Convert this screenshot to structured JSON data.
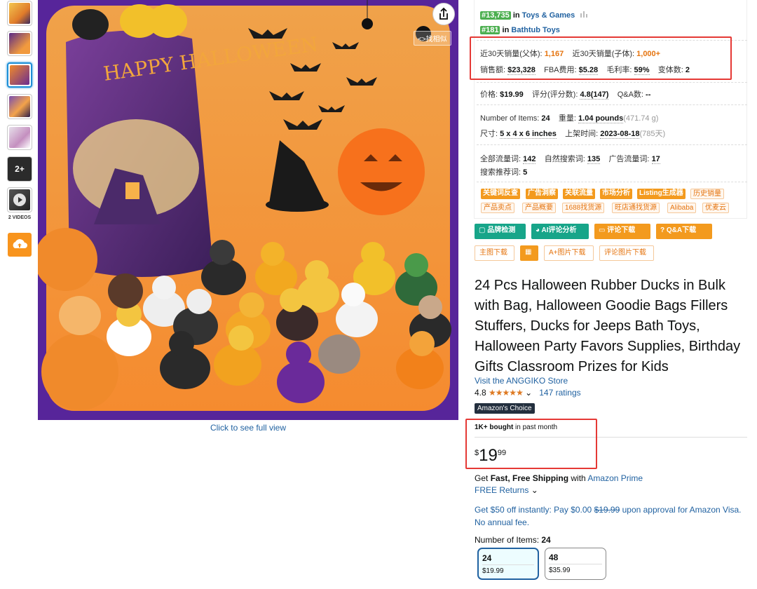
{
  "gallery": {
    "thumbnails": [
      {
        "name": "thumb-1",
        "color": "#e8a940"
      },
      {
        "name": "thumb-2",
        "color": "#7c3a9a"
      },
      {
        "name": "thumb-3",
        "color": "#f08a2b"
      },
      {
        "name": "thumb-4",
        "color": "#6a4aa0"
      },
      {
        "name": "thumb-5",
        "color": "#d9d3e0"
      },
      {
        "name": "thumb-6",
        "color": "#1a1a1a"
      },
      {
        "name": "thumb-7",
        "color": "#444"
      }
    ],
    "more_label": "2+",
    "videos_label": "2 VIDEOS",
    "full_view": "Click to see full view",
    "zh_tag": "<>找相似",
    "image_text": "HAPPY HALLOWEEN"
  },
  "ranks": [
    {
      "badge": "#13,735",
      "in": "in",
      "cat": "Toys & Games"
    },
    {
      "badge": "#181",
      "in": "in",
      "cat": "Bathtub Toys"
    }
  ],
  "stats": {
    "parent_sales_label": "近30天销量(父体):",
    "parent_sales": "1,167",
    "child_sales_label": "近30天销量(子体):",
    "child_sales": "1,000+",
    "revenue_label": "销售额:",
    "revenue": "$23,328",
    "fba_label": "FBA费用:",
    "fba": "$5.28",
    "margin_label": "毛利率:",
    "margin": "59%",
    "variants_label": "变体数:",
    "variants": "2",
    "price_label": "价格:",
    "price": "$19.99",
    "rating_label": "评分(评分数):",
    "rating": "4.8(147)",
    "qa_label": "Q&A数:",
    "qa": "--",
    "items_label": "Number of Items:",
    "items": "24",
    "weight_label": "重量:",
    "weight": "1.04 pounds",
    "weight_g": "(471.74 g)",
    "size_label": "尺寸:",
    "size": "5 x 4 x 6 inches",
    "listed_label": "上架时间:",
    "listed": "2023-08-18",
    "listed_days": "(785天)",
    "all_kw_label": "全部流量词:",
    "all_kw": "142",
    "organic_label": "自然搜索词:",
    "organic": "135",
    "ad_label": "广告流量词:",
    "ad": "17",
    "rec_label": "搜索推荐词:",
    "rec": "5"
  },
  "tags_row1": [
    "关键词反查",
    "广告洞察",
    "关联流量",
    "市场分析",
    "Listing生成器",
    "历史销量"
  ],
  "tags_row2": [
    "产品卖点",
    "产品概要",
    "1688找货源",
    "旺店通找货源",
    "Alibaba",
    "优麦云"
  ],
  "buttons_row1": [
    "品牌检测",
    "AI评论分析",
    "评论下载",
    "Q&A下载"
  ],
  "buttons_row2": [
    "主图下载",
    "A+图片下载",
    "评论图片下载"
  ],
  "product": {
    "title": "24 Pcs Halloween Rubber Ducks in Bulk with Bag, Halloween Goodie Bags Fillers Stuffers, Ducks for Jeeps Bath Toys, Halloween Party Favors Supplies, Birthday Gifts Classroom Prizes for Kids",
    "store": "Visit the ANGGIKO Store",
    "rating": "4.8",
    "stars": "★★★★★",
    "ratings_count": "147 ratings",
    "choice": "Amazon's Choice",
    "bought_bold": "1K+ bought",
    "bought_rest": " in past month",
    "price_symbol": "$",
    "price_whole": "19",
    "price_frac": "99",
    "ship_pre": "Get ",
    "ship_bold": "Fast, Free Shipping",
    "ship_mid": " with ",
    "ship_link": "Amazon Prime",
    "returns": "FREE Returns",
    "offer_pre": "Get $50 off instantly: Pay $0.00 ",
    "offer_strike": "$19.99",
    "offer_post": " upon approval for Amazon Visa. No annual fee.",
    "items_label": "Number of Items: ",
    "items_value": "24",
    "options": [
      {
        "n": "24",
        "p": "$19.99"
      },
      {
        "n": "48",
        "p": "$35.99"
      }
    ]
  }
}
